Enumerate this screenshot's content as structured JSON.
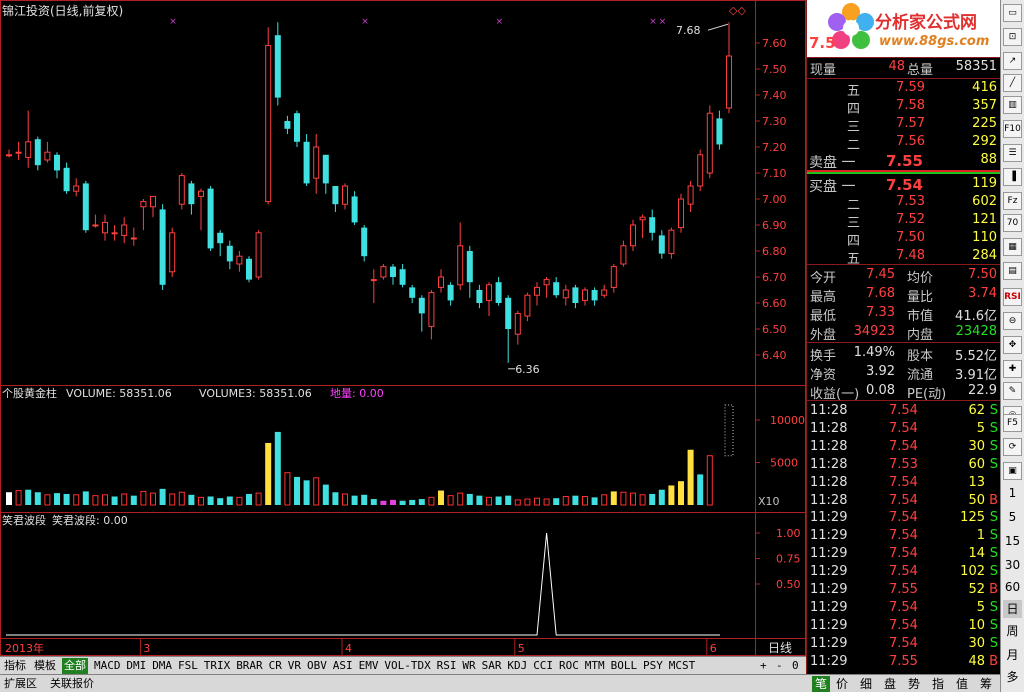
{
  "chart": {
    "title": "锦江投资(日线,前复权)",
    "high_label": "7.68",
    "low_label": "6.36",
    "price_ticks": [
      "7.60",
      "7.50",
      "7.40",
      "7.30",
      "7.20",
      "7.10",
      "7.00",
      "6.90",
      "6.80",
      "6.70",
      "6.60",
      "6.50",
      "6.40"
    ],
    "volume_ticks": [
      "10000",
      "5000"
    ],
    "volume_unit": "X10",
    "wave_ticks": [
      "1.00",
      "0.75",
      "0.50"
    ],
    "volume_header": {
      "name": "个股黄金柱",
      "vol_label": "VOLUME: 58351.06",
      "vol3_label": "VOLUME3: 58351.06",
      "diliang_label": "地量: 0.00"
    },
    "wave_header": {
      "name": "笑君波段",
      "value_label": "笑君波段: 0.00"
    },
    "date_labels": [
      "2013年",
      "3",
      "4",
      "5",
      "6"
    ],
    "period_label": "日线",
    "candles": [
      {
        "o": 7.17,
        "c": 7.17,
        "h": 7.19,
        "l": 7.16
      },
      {
        "o": 7.18,
        "c": 7.18,
        "h": 7.22,
        "l": 7.15
      },
      {
        "o": 7.16,
        "c": 7.22,
        "h": 7.34,
        "l": 7.12
      },
      {
        "o": 7.23,
        "c": 7.13,
        "h": 7.24,
        "l": 7.11
      },
      {
        "o": 7.15,
        "c": 7.18,
        "h": 7.22,
        "l": 7.14
      },
      {
        "o": 7.17,
        "c": 7.11,
        "h": 7.18,
        "l": 7.08
      },
      {
        "o": 7.12,
        "c": 7.03,
        "h": 7.14,
        "l": 7.02
      },
      {
        "o": 7.03,
        "c": 7.05,
        "h": 7.08,
        "l": 7.01
      },
      {
        "o": 7.06,
        "c": 6.88,
        "h": 7.07,
        "l": 6.87
      },
      {
        "o": 6.9,
        "c": 6.9,
        "h": 6.94,
        "l": 6.89
      },
      {
        "o": 6.87,
        "c": 6.91,
        "h": 6.94,
        "l": 6.84
      },
      {
        "o": 6.87,
        "c": 6.87,
        "h": 6.9,
        "l": 6.84
      },
      {
        "o": 6.86,
        "c": 6.9,
        "h": 6.93,
        "l": 6.83
      },
      {
        "o": 6.85,
        "c": 6.85,
        "h": 6.89,
        "l": 6.82
      },
      {
        "o": 6.97,
        "c": 6.99,
        "h": 7.0,
        "l": 6.88
      },
      {
        "o": 6.97,
        "c": 7.01,
        "h": 7.01,
        "l": 6.93
      },
      {
        "o": 6.96,
        "c": 6.67,
        "h": 6.98,
        "l": 6.65
      },
      {
        "o": 6.72,
        "c": 6.87,
        "h": 6.89,
        "l": 6.7
      },
      {
        "o": 6.98,
        "c": 7.09,
        "h": 7.1,
        "l": 6.96
      },
      {
        "o": 7.06,
        "c": 6.98,
        "h": 7.07,
        "l": 6.94
      },
      {
        "o": 7.01,
        "c": 7.03,
        "h": 7.04,
        "l": 6.88
      },
      {
        "o": 7.04,
        "c": 6.81,
        "h": 7.05,
        "l": 6.8
      },
      {
        "o": 6.87,
        "c": 6.83,
        "h": 6.88,
        "l": 6.78
      },
      {
        "o": 6.82,
        "c": 6.76,
        "h": 6.84,
        "l": 6.73
      },
      {
        "o": 6.75,
        "c": 6.78,
        "h": 6.8,
        "l": 6.72
      },
      {
        "o": 6.77,
        "c": 6.69,
        "h": 6.78,
        "l": 6.68
      },
      {
        "o": 6.7,
        "c": 6.87,
        "h": 6.88,
        "l": 6.69
      },
      {
        "o": 6.99,
        "c": 7.59,
        "h": 7.66,
        "l": 6.98
      },
      {
        "o": 7.63,
        "c": 7.39,
        "h": 7.68,
        "l": 7.36
      },
      {
        "o": 7.3,
        "c": 7.27,
        "h": 7.32,
        "l": 7.25
      },
      {
        "o": 7.33,
        "c": 7.22,
        "h": 7.34,
        "l": 7.2
      },
      {
        "o": 7.22,
        "c": 7.06,
        "h": 7.25,
        "l": 7.05
      },
      {
        "o": 7.08,
        "c": 7.2,
        "h": 7.25,
        "l": 7.02
      },
      {
        "o": 7.17,
        "c": 7.06,
        "h": 7.17,
        "l": 7.02
      },
      {
        "o": 7.05,
        "c": 6.98,
        "h": 7.05,
        "l": 6.95
      },
      {
        "o": 6.98,
        "c": 7.05,
        "h": 7.06,
        "l": 6.96
      },
      {
        "o": 7.01,
        "c": 6.91,
        "h": 7.03,
        "l": 6.9
      },
      {
        "o": 6.89,
        "c": 6.78,
        "h": 6.9,
        "l": 6.76
      },
      {
        "o": 6.69,
        "c": 6.69,
        "h": 6.73,
        "l": 6.6
      },
      {
        "o": 6.7,
        "c": 6.74,
        "h": 6.75,
        "l": 6.69
      },
      {
        "o": 6.74,
        "c": 6.7,
        "h": 6.75,
        "l": 6.67
      },
      {
        "o": 6.73,
        "c": 6.67,
        "h": 6.75,
        "l": 6.66
      },
      {
        "o": 6.66,
        "c": 6.62,
        "h": 6.67,
        "l": 6.6
      },
      {
        "o": 6.62,
        "c": 6.56,
        "h": 6.63,
        "l": 6.49
      },
      {
        "o": 6.51,
        "c": 6.64,
        "h": 6.65,
        "l": 6.46
      },
      {
        "o": 6.66,
        "c": 6.7,
        "h": 6.73,
        "l": 6.64
      },
      {
        "o": 6.67,
        "c": 6.61,
        "h": 6.68,
        "l": 6.59
      },
      {
        "o": 6.67,
        "c": 6.82,
        "h": 6.91,
        "l": 6.65
      },
      {
        "o": 6.8,
        "c": 6.68,
        "h": 6.82,
        "l": 6.62
      },
      {
        "o": 6.65,
        "c": 6.6,
        "h": 6.67,
        "l": 6.58
      },
      {
        "o": 6.61,
        "c": 6.67,
        "h": 6.68,
        "l": 6.55
      },
      {
        "o": 6.68,
        "c": 6.6,
        "h": 6.7,
        "l": 6.59
      },
      {
        "o": 6.62,
        "c": 6.5,
        "h": 6.63,
        "l": 6.37
      },
      {
        "o": 6.48,
        "c": 6.56,
        "h": 6.57,
        "l": 6.44
      },
      {
        "o": 6.55,
        "c": 6.63,
        "h": 6.64,
        "l": 6.53
      },
      {
        "o": 6.63,
        "c": 6.66,
        "h": 6.68,
        "l": 6.59
      },
      {
        "o": 6.67,
        "c": 6.69,
        "h": 6.7,
        "l": 6.62
      },
      {
        "o": 6.68,
        "c": 6.63,
        "h": 6.7,
        "l": 6.62
      },
      {
        "o": 6.62,
        "c": 6.65,
        "h": 6.67,
        "l": 6.59
      },
      {
        "o": 6.66,
        "c": 6.6,
        "h": 6.67,
        "l": 6.58
      },
      {
        "o": 6.61,
        "c": 6.65,
        "h": 6.66,
        "l": 6.59
      },
      {
        "o": 6.65,
        "c": 6.61,
        "h": 6.66,
        "l": 6.59
      },
      {
        "o": 6.63,
        "c": 6.65,
        "h": 6.67,
        "l": 6.62
      },
      {
        "o": 6.66,
        "c": 6.74,
        "h": 6.75,
        "l": 6.64
      },
      {
        "o": 6.75,
        "c": 6.82,
        "h": 6.84,
        "l": 6.74
      },
      {
        "o": 6.82,
        "c": 6.9,
        "h": 6.92,
        "l": 6.8
      },
      {
        "o": 6.92,
        "c": 6.93,
        "h": 6.94,
        "l": 6.85
      },
      {
        "o": 6.93,
        "c": 6.87,
        "h": 6.96,
        "l": 6.84
      },
      {
        "o": 6.86,
        "c": 6.79,
        "h": 6.88,
        "l": 6.77
      },
      {
        "o": 6.79,
        "c": 6.88,
        "h": 6.89,
        "l": 6.77
      },
      {
        "o": 6.89,
        "c": 7.0,
        "h": 7.02,
        "l": 6.87
      },
      {
        "o": 6.98,
        "c": 7.05,
        "h": 7.07,
        "l": 6.95
      },
      {
        "o": 7.05,
        "c": 7.17,
        "h": 7.19,
        "l": 7.03
      },
      {
        "o": 7.1,
        "c": 7.33,
        "h": 7.36,
        "l": 7.08
      },
      {
        "o": 7.31,
        "c": 7.21,
        "h": 7.34,
        "l": 7.19
      },
      {
        "o": 7.35,
        "c": 7.55,
        "h": 7.68,
        "l": 7.33
      }
    ],
    "volumes": [
      {
        "v": 1500,
        "c": "white"
      },
      {
        "v": 1700,
        "c": "red"
      },
      {
        "v": 1800,
        "c": "cyan"
      },
      {
        "v": 1500,
        "c": "cyan"
      },
      {
        "v": 1200,
        "c": "red"
      },
      {
        "v": 1400,
        "c": "cyan"
      },
      {
        "v": 1300,
        "c": "cyan"
      },
      {
        "v": 1200,
        "c": "red"
      },
      {
        "v": 1600,
        "c": "cyan"
      },
      {
        "v": 1100,
        "c": "red"
      },
      {
        "v": 1200,
        "c": "red"
      },
      {
        "v": 1000,
        "c": "cyan"
      },
      {
        "v": 1300,
        "c": "red"
      },
      {
        "v": 1100,
        "c": "cyan"
      },
      {
        "v": 1600,
        "c": "red"
      },
      {
        "v": 1400,
        "c": "red"
      },
      {
        "v": 1900,
        "c": "cyan"
      },
      {
        "v": 1300,
        "c": "red"
      },
      {
        "v": 1500,
        "c": "red"
      },
      {
        "v": 1200,
        "c": "cyan"
      },
      {
        "v": 900,
        "c": "red"
      },
      {
        "v": 1000,
        "c": "cyan"
      },
      {
        "v": 800,
        "c": "cyan"
      },
      {
        "v": 1000,
        "c": "cyan"
      },
      {
        "v": 900,
        "c": "red"
      },
      {
        "v": 1300,
        "c": "cyan"
      },
      {
        "v": 1400,
        "c": "red"
      },
      {
        "v": 7300,
        "c": "yellow"
      },
      {
        "v": 8600,
        "c": "cyan"
      },
      {
        "v": 3800,
        "c": "red"
      },
      {
        "v": 3300,
        "c": "cyan"
      },
      {
        "v": 2900,
        "c": "cyan"
      },
      {
        "v": 3200,
        "c": "red"
      },
      {
        "v": 2400,
        "c": "cyan"
      },
      {
        "v": 1500,
        "c": "cyan"
      },
      {
        "v": 1300,
        "c": "red"
      },
      {
        "v": 1100,
        "c": "cyan"
      },
      {
        "v": 1200,
        "c": "cyan"
      },
      {
        "v": 700,
        "c": "cyan"
      },
      {
        "v": 500,
        "c": "magenta"
      },
      {
        "v": 600,
        "c": "magenta"
      },
      {
        "v": 500,
        "c": "cyan"
      },
      {
        "v": 600,
        "c": "cyan"
      },
      {
        "v": 700,
        "c": "cyan"
      },
      {
        "v": 900,
        "c": "red"
      },
      {
        "v": 1700,
        "c": "yellow"
      },
      {
        "v": 1100,
        "c": "red"
      },
      {
        "v": 1400,
        "c": "red"
      },
      {
        "v": 1300,
        "c": "cyan"
      },
      {
        "v": 1100,
        "c": "cyan"
      },
      {
        "v": 900,
        "c": "red"
      },
      {
        "v": 1000,
        "c": "cyan"
      },
      {
        "v": 1100,
        "c": "cyan"
      },
      {
        "v": 600,
        "c": "red"
      },
      {
        "v": 700,
        "c": "red"
      },
      {
        "v": 800,
        "c": "red"
      },
      {
        "v": 700,
        "c": "red"
      },
      {
        "v": 800,
        "c": "cyan"
      },
      {
        "v": 1000,
        "c": "red"
      },
      {
        "v": 1100,
        "c": "cyan"
      },
      {
        "v": 1000,
        "c": "red"
      },
      {
        "v": 900,
        "c": "cyan"
      },
      {
        "v": 1200,
        "c": "red"
      },
      {
        "v": 1600,
        "c": "yellow"
      },
      {
        "v": 1500,
        "c": "red"
      },
      {
        "v": 1400,
        "c": "red"
      },
      {
        "v": 1200,
        "c": "red"
      },
      {
        "v": 1300,
        "c": "cyan"
      },
      {
        "v": 1800,
        "c": "cyan"
      },
      {
        "v": 2300,
        "c": "yellow"
      },
      {
        "v": 2800,
        "c": "yellow"
      },
      {
        "v": 6500,
        "c": "yellow"
      },
      {
        "v": 3600,
        "c": "cyan"
      },
      {
        "v": 5800,
        "c": "red"
      }
    ],
    "wave_peak_index": 56
  },
  "quote": {
    "price": "7.5",
    "xianliang_label": "现量",
    "xianliang": "48",
    "zongliang_label": "总量",
    "zongliang": "58351",
    "asks": [
      {
        "label": "五",
        "price": "7.59",
        "vol": "416"
      },
      {
        "label": "四",
        "price": "7.58",
        "vol": "357"
      },
      {
        "label": "三",
        "price": "7.57",
        "vol": "225"
      },
      {
        "label": "二",
        "price": "7.56",
        "vol": "292"
      },
      {
        "label": "卖盘 一",
        "price": "7.55",
        "vol": "88"
      }
    ],
    "bids": [
      {
        "label": "买盘 一",
        "price": "7.54",
        "vol": "119"
      },
      {
        "label": "二",
        "price": "7.53",
        "vol": "602"
      },
      {
        "label": "三",
        "price": "7.52",
        "vol": "121"
      },
      {
        "label": "四",
        "price": "7.50",
        "vol": "110"
      },
      {
        "label": "五",
        "price": "7.48",
        "vol": "284"
      }
    ],
    "stats": [
      {
        "l1": "今开",
        "v1": "7.45",
        "c1": "red",
        "l2": "均价",
        "v2": "7.50",
        "c2": "red"
      },
      {
        "l1": "最高",
        "v1": "7.68",
        "c1": "red",
        "l2": "量比",
        "v2": "3.74",
        "c2": "red"
      },
      {
        "l1": "最低",
        "v1": "7.33",
        "c1": "red",
        "l2": "市值",
        "v2": "41.6亿",
        "c2": "white"
      },
      {
        "l1": "外盘",
        "v1": "34923",
        "c1": "red",
        "l2": "内盘",
        "v2": "23428",
        "c2": "green"
      }
    ],
    "stats2": [
      {
        "l1": "换手",
        "v1": "1.49%",
        "l2": "股本",
        "v2": "5.52亿"
      },
      {
        "l1": "净资",
        "v1": "3.92",
        "l2": "流通",
        "v2": "3.91亿"
      },
      {
        "l1": "收益(一)",
        "v1": "0.08",
        "l2": "PE(动)",
        "v2": "22.9"
      }
    ],
    "ticks": [
      {
        "t": "11:28",
        "p": "7.54",
        "v": "62",
        "s": "S"
      },
      {
        "t": "11:28",
        "p": "7.54",
        "v": "5",
        "s": "S"
      },
      {
        "t": "11:28",
        "p": "7.54",
        "v": "30",
        "s": "S"
      },
      {
        "t": "11:28",
        "p": "7.53",
        "v": "60",
        "s": "S"
      },
      {
        "t": "11:28",
        "p": "7.54",
        "v": "13",
        "s": ""
      },
      {
        "t": "11:28",
        "p": "7.54",
        "v": "50",
        "s": "B"
      },
      {
        "t": "11:29",
        "p": "7.54",
        "v": "125",
        "s": "S"
      },
      {
        "t": "11:29",
        "p": "7.54",
        "v": "1",
        "s": "S"
      },
      {
        "t": "11:29",
        "p": "7.54",
        "v": "14",
        "s": "S"
      },
      {
        "t": "11:29",
        "p": "7.54",
        "v": "102",
        "s": "S"
      },
      {
        "t": "11:29",
        "p": "7.55",
        "v": "52",
        "s": "B"
      },
      {
        "t": "11:29",
        "p": "7.54",
        "v": "5",
        "s": "S"
      },
      {
        "t": "11:29",
        "p": "7.54",
        "v": "10",
        "s": "S"
      },
      {
        "t": "11:29",
        "p": "7.54",
        "v": "30",
        "s": "S"
      },
      {
        "t": "11:29",
        "p": "7.55",
        "v": "48",
        "s": "B"
      }
    ]
  },
  "logo": {
    "text": "分析家公式网",
    "url_text": "www.88gs.com"
  },
  "tabs": [
    "指标",
    "模板",
    "全部",
    "MACD",
    "DMI",
    "DMA",
    "FSL",
    "TRIX",
    "BRAR",
    "CR",
    "VR",
    "OBV",
    "ASI",
    "EMV",
    "VOL-TDX",
    "RSI",
    "WR",
    "SAR",
    "KDJ",
    "CCI",
    "ROC",
    "MTM",
    "BOLL",
    "PSY",
    "MCST"
  ],
  "tab_controls": [
    "+",
    "-",
    "0"
  ],
  "tabs2": [
    "扩展区",
    "关联报价"
  ],
  "panel_tabs": [
    "笔",
    "价",
    "细",
    "盘",
    "势",
    "指",
    "值",
    "筹"
  ],
  "toolbar": [
    "F10",
    "RSI",
    "F5",
    "日",
    "周",
    "月",
    "多",
    "1",
    "5",
    "15",
    "30",
    "60"
  ],
  "colors": {
    "up": "#ff4040",
    "down": "#40e0e0",
    "axis": "#b02020"
  }
}
